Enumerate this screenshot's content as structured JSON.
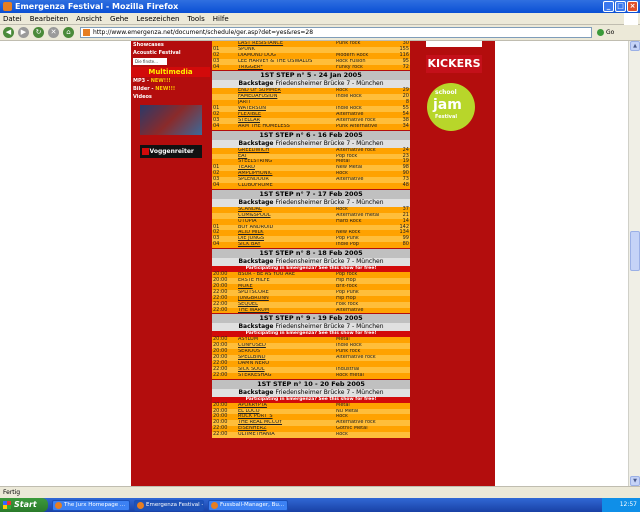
{
  "window": {
    "title": "Emergenza Festival - Mozilla Firefox"
  },
  "menu": [
    "Datei",
    "Bearbeiten",
    "Ansicht",
    "Gehe",
    "Lesezeichen",
    "Tools",
    "Hilfe"
  ],
  "address": {
    "url": "http://www.emergenza.net/document/schedule/ger.asp?det=yes&res=28",
    "go": "Go"
  },
  "left": {
    "links": [
      "Showcases",
      "Acoustic Festival"
    ],
    "find_placeholder": "Die finste...",
    "multimedia": "Multimedia",
    "mp3": "MP3",
    "bilder": "Bilder",
    "videos": "Videos",
    "new_label": "NEW!!!",
    "banner": "Voggenreiter"
  },
  "right": {
    "kickers": "KICKERS",
    "jam_school": "school",
    "jam_main": "jam",
    "jam_fest": "Festival"
  },
  "top_rows": [
    {
      "num": "",
      "band": "LAST RESISTANCE",
      "style": "Punk rock",
      "votes": "30",
      "u": true
    },
    {
      "num": "01",
      "band": "SPUNK",
      "style": "",
      "votes": "155",
      "u": false
    },
    {
      "num": "02",
      "band": "DIAMOND DOG",
      "style": "Modern Rock",
      "votes": "116",
      "u": false
    },
    {
      "num": "03",
      "band": "LEE HARVEY & THE OSWALDS",
      "style": "Rock Fusion",
      "votes": "95",
      "u": false
    },
    {
      "num": "04",
      "band": "TRIGGER*",
      "style": "Funky rock",
      "votes": "72",
      "u": true
    }
  ],
  "venue": "Friedensheimer Brücke 7 - München",
  "backstage": "Backstage",
  "promo_text": "Participating in Emergenza? See this show for free!",
  "steps": [
    {
      "title": "1ST STEP n° 5 - 24 Jan 2005",
      "promo": false,
      "rows": [
        {
          "num": "",
          "band": "END OF SUMMER",
          "style": "Rock",
          "votes": "29",
          "u": true
        },
        {
          "num": "",
          "band": "FAMEDAFUSION",
          "style": "Indie Rock",
          "votes": "20",
          "u": true
        },
        {
          "num": "",
          "band": "JARIT",
          "style": "",
          "votes": "8",
          "u": false
        },
        {
          "num": "01",
          "band": "WATERSUN",
          "style": "Indie Rock",
          "votes": "55",
          "u": true
        },
        {
          "num": "02",
          "band": "FLEXIBLE",
          "style": "Alternative",
          "votes": "54",
          "u": true
        },
        {
          "num": "03",
          "band": "STELLAR",
          "style": "Alternative rock",
          "votes": "38",
          "u": true
        },
        {
          "num": "04",
          "band": "ARM THE HOMELESS",
          "style": "Punk Alternative",
          "votes": "34",
          "u": false
        }
      ]
    },
    {
      "title": "1ST STEP n° 6 - 16 Feb 2005",
      "promo": false,
      "rows": [
        {
          "num": "",
          "band": "GREEDWICH",
          "style": "Alternative rock",
          "votes": "24",
          "u": true
        },
        {
          "num": "",
          "band": "EAT",
          "style": "Pop rock",
          "votes": "23",
          "u": true
        },
        {
          "num": "",
          "band": "STEELSTRING",
          "style": "Metal",
          "votes": "19",
          "u": false
        },
        {
          "num": "01",
          "band": "TEARD",
          "style": "New Metal",
          "votes": "98",
          "u": true
        },
        {
          "num": "02",
          "band": "AMPLIPHONIC",
          "style": "Rock",
          "votes": "90",
          "u": true
        },
        {
          "num": "03",
          "band": "SPLENDOUR",
          "style": "Alternative",
          "votes": "73",
          "u": false
        },
        {
          "num": "04",
          "band": "CLUBOFROME",
          "style": "",
          "votes": "48",
          "u": false
        }
      ]
    },
    {
      "title": "1ST STEP n° 7 - 17 Feb 2005",
      "promo": false,
      "rows": [
        {
          "num": "",
          "band": "SCANDAL",
          "style": "Rock",
          "votes": "37",
          "u": true
        },
        {
          "num": "",
          "band": "COM&SPOOL",
          "style": "Alternative metal",
          "votes": "21",
          "u": true
        },
        {
          "num": "",
          "band": "UTOPIA",
          "style": "Hard Rock",
          "votes": "14",
          "u": false
        },
        {
          "num": "01",
          "band": "BOY ANDROID",
          "style": "",
          "votes": "142",
          "u": false
        },
        {
          "num": "02",
          "band": "ACID MILK",
          "style": "New Rock",
          "votes": "134",
          "u": true
        },
        {
          "num": "03",
          "band": "DIE JUNGS",
          "style": "Pop Punk",
          "votes": "99",
          "u": true
        },
        {
          "num": "04",
          "band": "SICK BAY",
          "style": "Indie Pop",
          "votes": "80",
          "u": true
        }
      ]
    },
    {
      "title": "1ST STEP n° 8 - 18 Feb 2005",
      "promo": true,
      "rows": [
        {
          "num": "20:00",
          "band": "BSUR - BE AS YOU ARE",
          "style": "Pop rock",
          "votes": "",
          "u": false
        },
        {
          "num": "20:00",
          "band": "ERSTE HILFE",
          "style": "Hip Hop",
          "votes": "",
          "u": false
        },
        {
          "num": "20:00",
          "band": "MOKE",
          "style": "Brit-rock",
          "votes": "",
          "u": true
        },
        {
          "num": "22:00",
          "band": "SPLITSCORE",
          "style": "Pop Punk",
          "votes": "",
          "u": false
        },
        {
          "num": "22:00",
          "band": "JUNGBRUNN",
          "style": "Hip Hop",
          "votes": "",
          "u": true
        },
        {
          "num": "22:00",
          "band": "SEQUEL",
          "style": "Folk rock",
          "votes": "",
          "u": true
        },
        {
          "num": "22:00",
          "band": "THE WARUM",
          "style": "Alternative",
          "votes": "",
          "u": true
        }
      ]
    },
    {
      "title": "1ST STEP n° 9 - 19 Feb 2005",
      "promo": true,
      "rows": [
        {
          "num": "20:00",
          "band": "ASYLUM",
          "style": "Metal",
          "votes": "",
          "u": false
        },
        {
          "num": "20:00",
          "band": "CONFUSED",
          "style": "Indie Rock",
          "votes": "",
          "u": true
        },
        {
          "num": "20:00",
          "band": "SERIOUS",
          "style": "Punk rock",
          "votes": "",
          "u": false
        },
        {
          "num": "20:00",
          "band": "SPELLBIND",
          "style": "Alternative rock",
          "votes": "",
          "u": true
        },
        {
          "num": "22:00",
          "band": "DAMN NERO",
          "style": "",
          "votes": "",
          "u": false
        },
        {
          "num": "22:00",
          "band": "SICK SOUL",
          "style": "Industrial",
          "votes": "",
          "u": true
        },
        {
          "num": "22:00",
          "band": "STERKESHAG",
          "style": "Rock metal",
          "votes": "",
          "u": false
        }
      ]
    },
    {
      "title": "1ST STEP n° 10 - 20 Feb 2005",
      "promo": true,
      "rows": [
        {
          "num": "20:00",
          "band": "APOKRYPTA",
          "style": "Metal",
          "votes": "",
          "u": true
        },
        {
          "num": "20:00",
          "band": "EL LOCO",
          "style": "Nu Metal",
          "votes": "",
          "u": true
        },
        {
          "num": "20:00",
          "band": "ROCK PORT`S",
          "style": "Rock",
          "votes": "",
          "u": true
        },
        {
          "num": "20:00",
          "band": "THE REAL MCCOY",
          "style": "Alternative rock",
          "votes": "",
          "u": true
        },
        {
          "num": "22:00",
          "band": "EISENHERZ",
          "style": "Gothic Metal",
          "votes": "",
          "u": true
        },
        {
          "num": "22:00",
          "band": "ULTIMETHANIA",
          "style": "Rock",
          "votes": "",
          "u": false
        }
      ]
    }
  ],
  "status": "Fertig",
  "taskbar": {
    "start": "Start",
    "tasks": [
      "The Jurx Homepage ...",
      "Emergenza Festival - ...",
      "Fussball-Manager, Bu..."
    ],
    "clock": "12:57"
  }
}
